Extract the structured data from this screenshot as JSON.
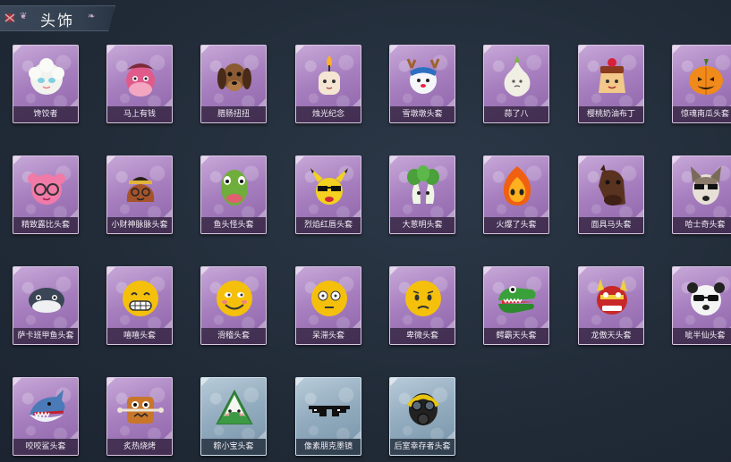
{
  "header": {
    "title": "头饰"
  },
  "items": [
    {
      "name": "馋饺者",
      "icon": "dumpling-icon",
      "frame": "purple"
    },
    {
      "name": "马上有钱",
      "icon": "pink-horse-icon",
      "frame": "purple"
    },
    {
      "name": "腊肠扭扭",
      "icon": "sausage-dog-icon",
      "frame": "purple"
    },
    {
      "name": "烛光纪念",
      "icon": "candle-head-icon",
      "frame": "purple"
    },
    {
      "name": "雪墩墩头套",
      "icon": "snow-deer-icon",
      "frame": "purple"
    },
    {
      "name": "蒜了八",
      "icon": "garlic-icon",
      "frame": "purple"
    },
    {
      "name": "樱桃奶油布丁",
      "icon": "pudding-icon",
      "frame": "purple"
    },
    {
      "name": "惊魂南瓜头套",
      "icon": "pumpkin-icon",
      "frame": "purple"
    },
    {
      "name": "精致露比头套",
      "icon": "pink-glasses-face-icon",
      "frame": "purple"
    },
    {
      "name": "小财神脉脉头套",
      "icon": "money-bag-icon",
      "frame": "purple"
    },
    {
      "name": "鱼头怪头套",
      "icon": "fish-head-icon",
      "frame": "purple"
    },
    {
      "name": "烈焰红唇头套",
      "icon": "yellow-mouse-sunglasses-icon",
      "frame": "purple"
    },
    {
      "name": "大葱明头套",
      "icon": "bok-choy-icon",
      "frame": "purple"
    },
    {
      "name": "火爆了头套",
      "icon": "fire-spirit-icon",
      "frame": "purple"
    },
    {
      "name": "面具马头套",
      "icon": "horse-mask-icon",
      "frame": "purple"
    },
    {
      "name": "哈士奇头套",
      "icon": "husky-sunglasses-icon",
      "frame": "purple"
    },
    {
      "name": "萨卡班甲鱼头套",
      "icon": "armored-fish-icon",
      "frame": "purple"
    },
    {
      "name": "嘻嘻头套",
      "icon": "grin-emoji-icon",
      "frame": "purple"
    },
    {
      "name": "滑稽头套",
      "icon": "funny-emoji-icon",
      "frame": "purple"
    },
    {
      "name": "呆滞头套",
      "icon": "dazed-emoji-icon",
      "frame": "purple"
    },
    {
      "name": "卑微头套",
      "icon": "pleading-emoji-icon",
      "frame": "purple"
    },
    {
      "name": "鳄霸天头套",
      "icon": "crocodile-icon",
      "frame": "purple"
    },
    {
      "name": "龙傲天头套",
      "icon": "dragon-icon",
      "frame": "purple"
    },
    {
      "name": "呲半仙头套",
      "icon": "panda-sunglasses-icon",
      "frame": "purple"
    },
    {
      "name": "咬咬鲨头套",
      "icon": "shark-icon",
      "frame": "purple"
    },
    {
      "name": "炙热烧烤",
      "icon": "bbq-skewer-icon",
      "frame": "purple"
    },
    {
      "name": "粽小宝头套",
      "icon": "rice-dumpling-icon",
      "frame": "blue"
    },
    {
      "name": "像素朋克墨镜",
      "icon": "pixel-sunglasses-icon",
      "frame": "blue"
    },
    {
      "name": "后室幸存者头套",
      "icon": "gas-mask-icon",
      "frame": "blue"
    }
  ]
}
